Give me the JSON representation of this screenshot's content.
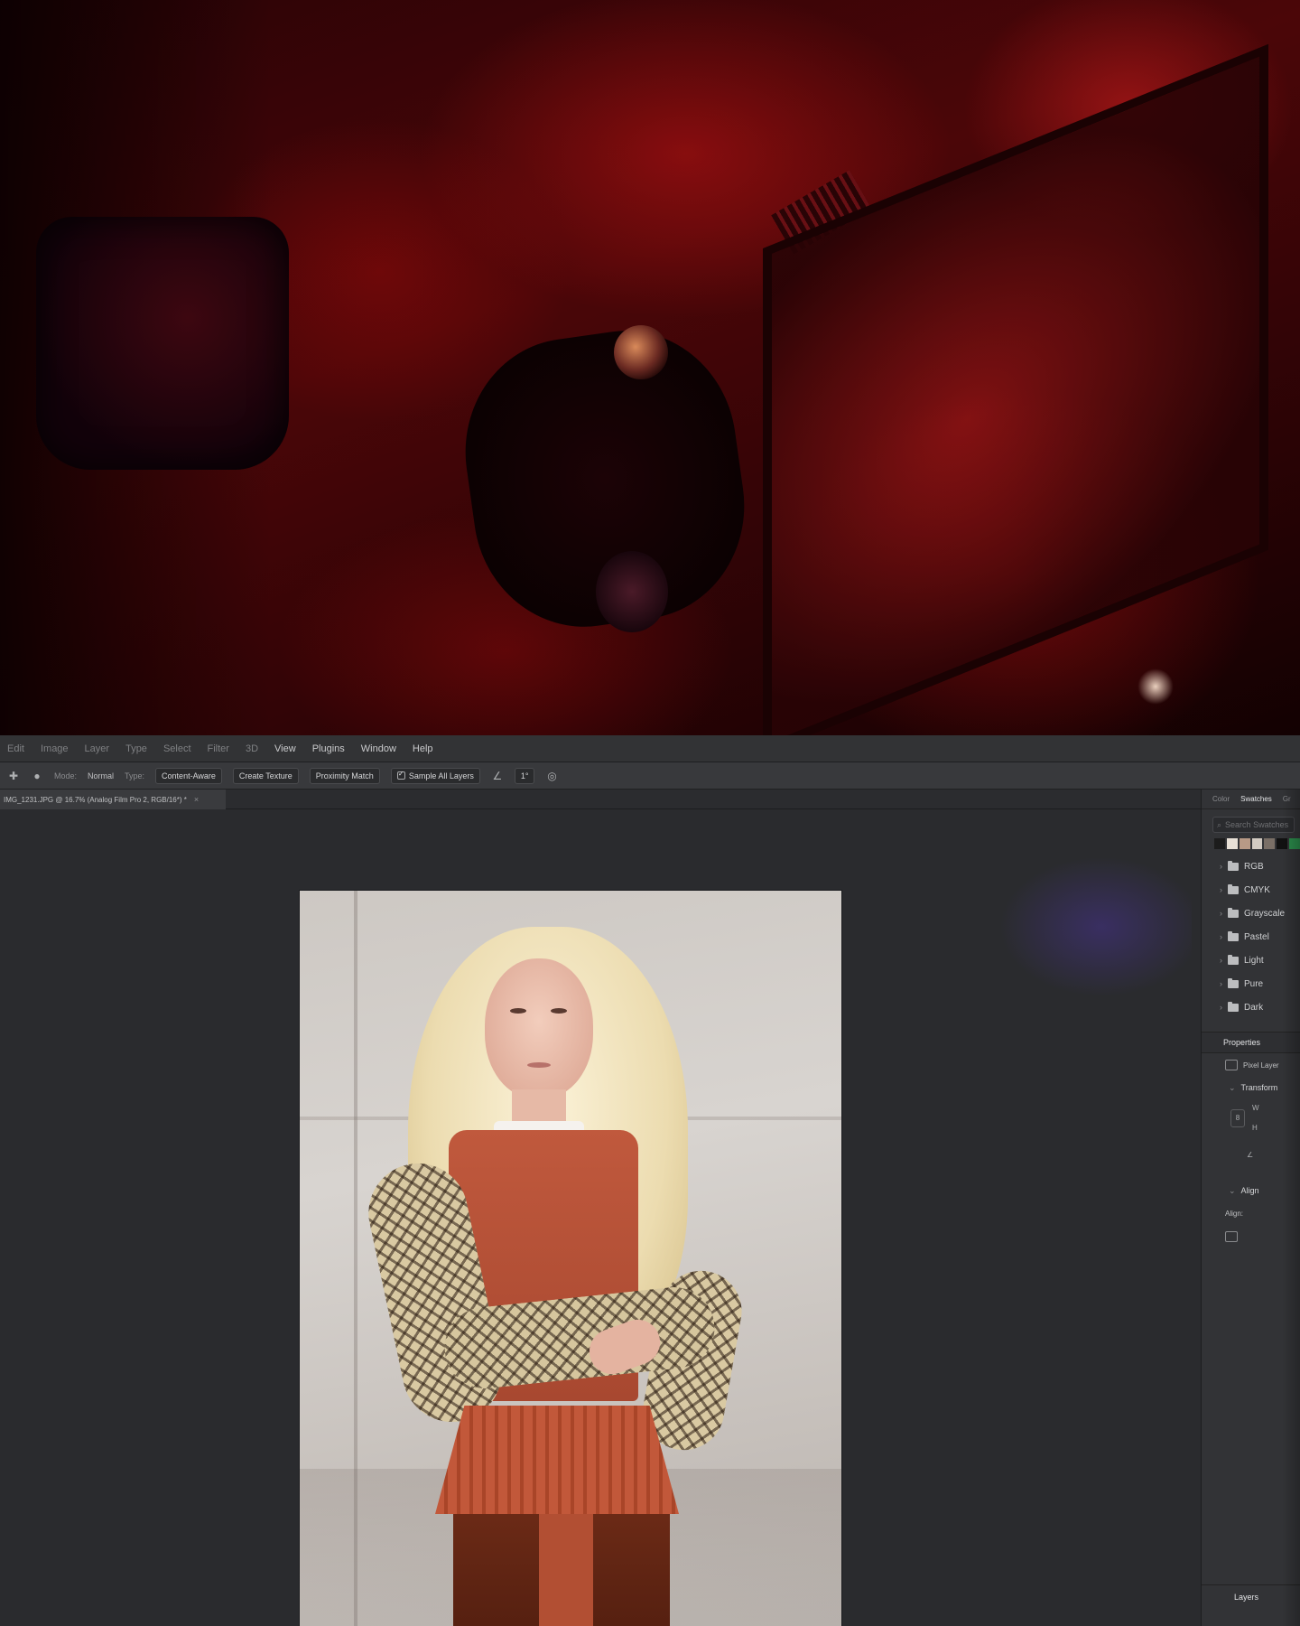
{
  "menubar": {
    "items": [
      "Edit",
      "Image",
      "Layer",
      "Type",
      "Select",
      "Filter",
      "3D",
      "View",
      "Plugins",
      "Window",
      "Help"
    ]
  },
  "options": {
    "mode_label": "Mode:",
    "mode_value": "Normal",
    "type_label": "Type:",
    "content_aware": "Content-Aware",
    "create_texture": "Create Texture",
    "proximity_match": "Proximity Match",
    "sample_all_layers": "Sample All Layers",
    "angle_value": "1°"
  },
  "document": {
    "tab_title": "IMG_1231.JPG @ 16.7% (Analog Film Pro 2, RGB/16*) *"
  },
  "panel": {
    "tabs": [
      "Color",
      "Swatches",
      "Gr"
    ],
    "active_tab": "Swatches",
    "search_placeholder": "Search Swatches",
    "swatch_colors": [
      "#1c1c1c",
      "#e8e0d6",
      "#b89a86",
      "#d3cbc2",
      "#7a6f66",
      "#111111",
      "#2a8a4a"
    ],
    "swatch_groups": [
      "RGB",
      "CMYK",
      "Grayscale",
      "Pastel",
      "Light",
      "Pure",
      "Dark"
    ],
    "properties_title": "Properties",
    "pixel_layer_label": "Pixel Layer",
    "transform_title": "Transform",
    "w_label": "W",
    "h_label": "H",
    "align_title": "Align",
    "align_to_label": "Align:",
    "layers_title": "Layers"
  }
}
